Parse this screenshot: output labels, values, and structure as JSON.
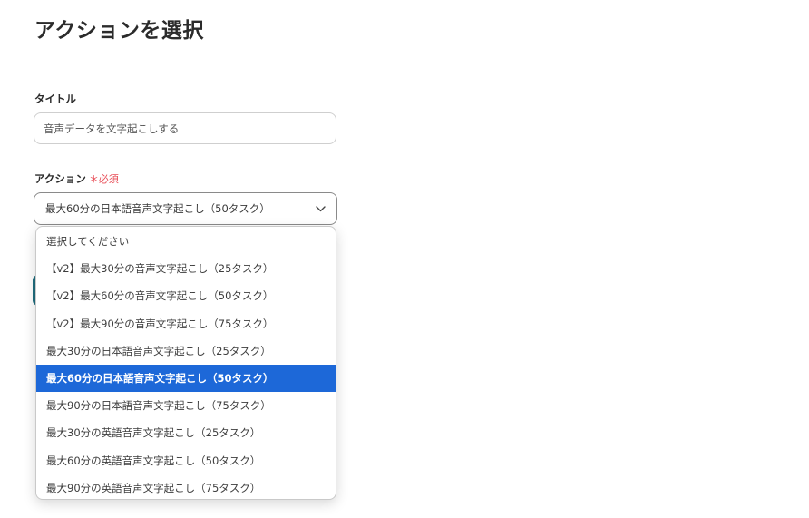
{
  "page": {
    "title": "アクションを選択"
  },
  "title_field": {
    "label": "タイトル",
    "value": "音声データを文字起こしする"
  },
  "action_field": {
    "label": "アクション",
    "required_mark": "＊必須",
    "selected_value": "最大60分の日本語音声文字起こし（50タスク）",
    "options": [
      "選択してください",
      "【v2】最大30分の音声文字起こし（25タスク）",
      "【v2】最大60分の音声文字起こし（50タスク）",
      "【v2】最大90分の音声文字起こし（75タスク）",
      "最大30分の日本語音声文字起こし（25タスク）",
      "最大60分の日本語音声文字起こし（50タスク）",
      "最大90分の日本語音声文字起こし（75タスク）",
      "最大30分の英語音声文字起こし（25タスク）",
      "最大60分の英語音声文字起こし（50タスク）",
      "最大90分の英語音声文字起こし（75タスク）"
    ],
    "selected_index": 5
  },
  "colors": {
    "highlight": "#1d68d8",
    "required": "#e84b55",
    "button": "#1f6d7e"
  },
  "icons": {
    "select_chevron": "chevron-down-icon"
  }
}
